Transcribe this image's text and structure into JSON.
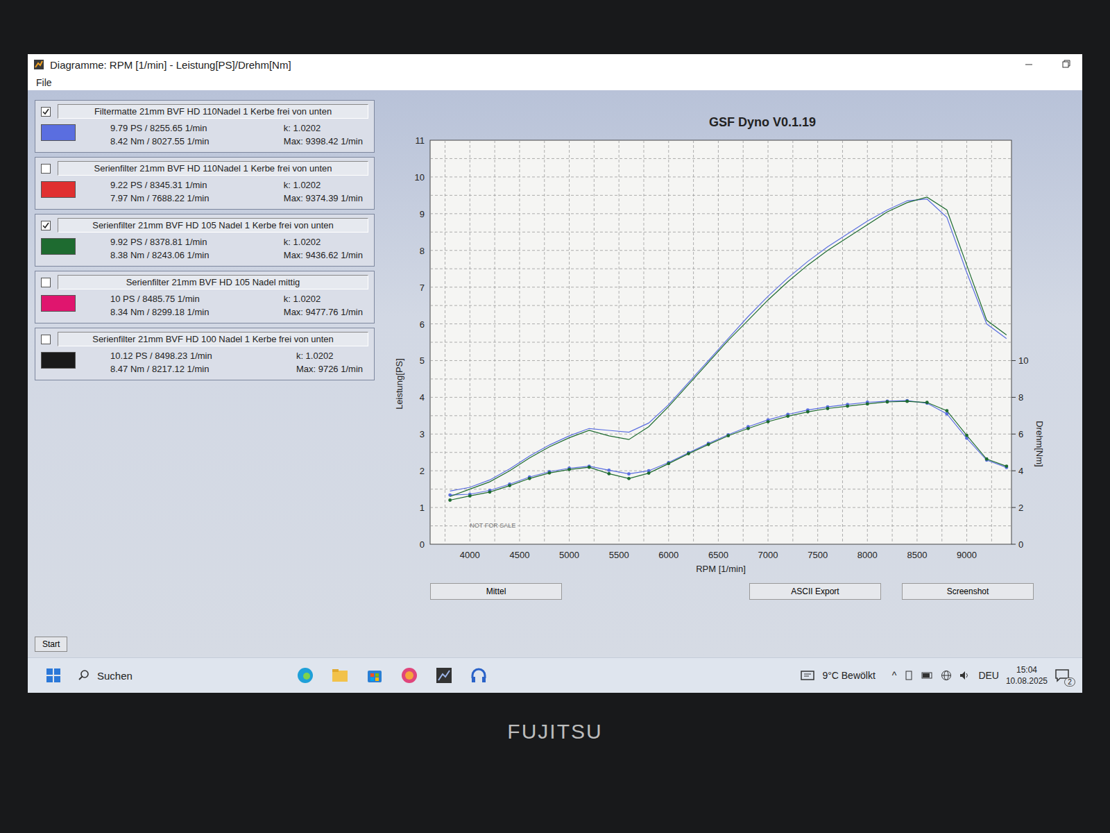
{
  "window": {
    "title": "Diagramme: RPM [1/min] - Leistung[PS]/Drehm[Nm]",
    "menu": [
      "File"
    ]
  },
  "legend": [
    {
      "label": "Filtermatte 21mm BVF HD 110Nadel 1 Kerbe frei von unten",
      "checked": true,
      "color": "#5a6ee0",
      "power_peak": "9.79 PS / 8255.65 1/min",
      "torque_peak": "8.42 Nm / 8027.55 1/min",
      "k": "k: 1.0202",
      "max": "Max: 9398.42 1/min",
      "power": [
        1.45,
        1.55,
        1.75,
        2.05,
        2.4,
        2.7,
        2.95,
        3.15,
        3.1,
        3.05,
        3.3,
        3.8,
        4.4,
        5.0,
        5.6,
        6.2,
        6.75,
        7.25,
        7.7,
        8.1,
        8.45,
        8.8,
        9.1,
        9.35,
        9.4,
        8.9,
        7.4,
        6.0,
        5.6
      ],
      "torque": [
        2.68,
        2.72,
        2.93,
        3.27,
        3.66,
        3.95,
        4.14,
        4.25,
        4.03,
        3.83,
        4.0,
        4.45,
        4.98,
        5.49,
        5.96,
        6.4,
        6.77,
        7.07,
        7.31,
        7.48,
        7.61,
        7.73,
        7.79,
        7.82,
        7.68,
        7.1,
        5.77,
        4.58,
        4.18
      ]
    },
    {
      "label": "Serienfilter 21mm BVF HD 110Nadel 1 Kerbe frei von unten",
      "checked": false,
      "color": "#e03030",
      "power_peak": "9.22 PS / 8345.31 1/min",
      "torque_peak": "7.97 Nm / 7688.22 1/min",
      "k": "k: 1.0202",
      "max": "Max: 9374.39 1/min"
    },
    {
      "label": "Serienfilter 21mm BVF HD 105 Nadel 1 Kerbe frei von unten",
      "checked": true,
      "color": "#1e6b30",
      "power_peak": "9.92 PS / 8378.81 1/min",
      "torque_peak": "8.38 Nm / 8243.06 1/min",
      "k": "k: 1.0202",
      "max": "Max: 9436.62 1/min",
      "power": [
        1.3,
        1.5,
        1.7,
        2.0,
        2.35,
        2.65,
        2.9,
        3.1,
        2.95,
        2.85,
        3.2,
        3.75,
        4.35,
        4.95,
        5.55,
        6.1,
        6.65,
        7.15,
        7.6,
        8.0,
        8.35,
        8.7,
        9.05,
        9.3,
        9.45,
        9.1,
        7.6,
        6.1,
        5.7
      ],
      "torque": [
        2.4,
        2.63,
        2.84,
        3.19,
        3.58,
        3.88,
        4.07,
        4.19,
        3.84,
        3.58,
        3.87,
        4.39,
        4.93,
        5.43,
        5.91,
        6.3,
        6.67,
        6.97,
        7.21,
        7.39,
        7.52,
        7.64,
        7.75,
        7.78,
        7.72,
        7.27,
        5.93,
        4.64,
        4.25
      ]
    },
    {
      "label": "Serienfilter 21mm BVF HD 105 Nadel mittig",
      "checked": false,
      "color": "#e0156e",
      "power_peak": "10 PS / 8485.75 1/min",
      "torque_peak": "8.34 Nm / 8299.18 1/min",
      "k": "k: 1.0202",
      "max": "Max: 9477.76 1/min"
    },
    {
      "label": "Serienfilter 21mm BVF HD 100 Nadel 1 Kerbe frei von unten",
      "checked": false,
      "color": "#1a1a1a",
      "power_peak": "10.12 PS / 8498.23 1/min",
      "torque_peak": "8.47 Nm / 8217.12 1/min",
      "k": "k: 1.0202",
      "max": "Max: 9726 1/min"
    }
  ],
  "start_button": "Start",
  "chart": {
    "title": "GSF Dyno V0.1.19",
    "y_label": "Leistung[PS]",
    "y2_label": "Drehm[Nm]",
    "x_label": "RPM [1/min]",
    "watermark": "NOT FOR SALE",
    "x_ticks": [
      "4000",
      "4500",
      "5000",
      "5500",
      "6000",
      "6500",
      "7000",
      "7500",
      "8000",
      "8500",
      "9000"
    ],
    "y_ticks": [
      "0",
      "1",
      "2",
      "3",
      "4",
      "5",
      "6",
      "7",
      "8",
      "9",
      "10",
      "11"
    ],
    "y2_ticks": [
      "0",
      "2",
      "4",
      "6",
      "8",
      "10"
    ],
    "rpm": [
      3800,
      4000,
      4200,
      4400,
      4600,
      4800,
      5000,
      5200,
      5400,
      5600,
      5800,
      6000,
      6200,
      6400,
      6600,
      6800,
      7000,
      7200,
      7400,
      7600,
      7800,
      8000,
      8200,
      8400,
      8600,
      8800,
      9000,
      9200,
      9400
    ]
  },
  "buttons": [
    "Mittel",
    "ASCII Export",
    "Screenshot"
  ],
  "taskbar": {
    "search": "Suchen",
    "weather": "9°C Bewölkt",
    "tray_arrow": "^",
    "language": "DEU",
    "time": "15:04",
    "date": "10.08.2025",
    "notifications": "2"
  },
  "bezel": {
    "brand": "FUJITSU"
  }
}
